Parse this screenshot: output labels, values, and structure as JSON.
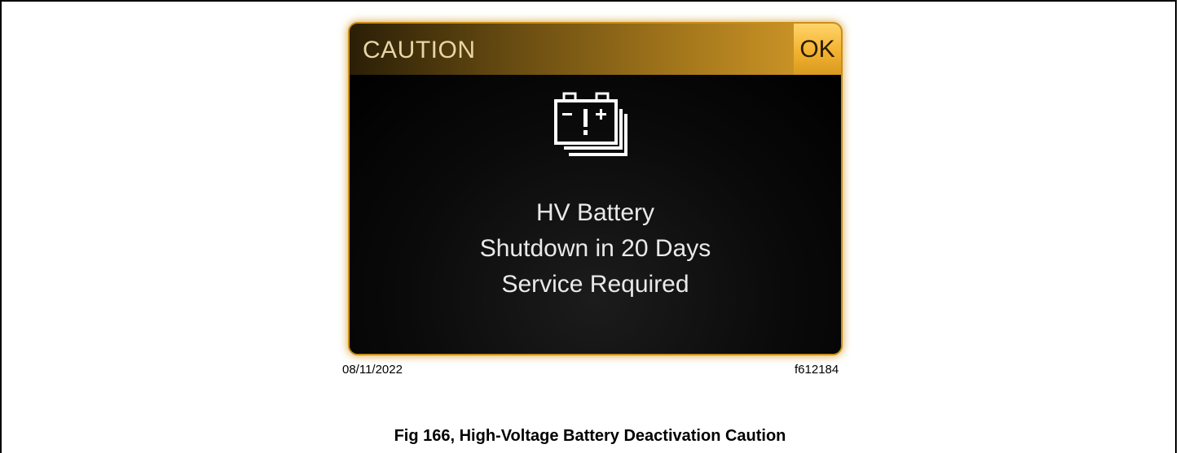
{
  "dialog": {
    "title": "CAUTION",
    "ok_label": "OK",
    "icon": "battery-warning-icon",
    "messages": [
      "HV Battery",
      "Shutdown in 20 Days",
      "Service Required"
    ]
  },
  "figure": {
    "date": "08/11/2022",
    "code": "f612184",
    "caption": "Fig 166, High-Voltage Battery Deactivation Caution"
  },
  "colors": {
    "header_gold": "#d79c2a",
    "ok_button": "#f2b230",
    "glow": "#c98e18",
    "screen_bg": "#000000"
  }
}
